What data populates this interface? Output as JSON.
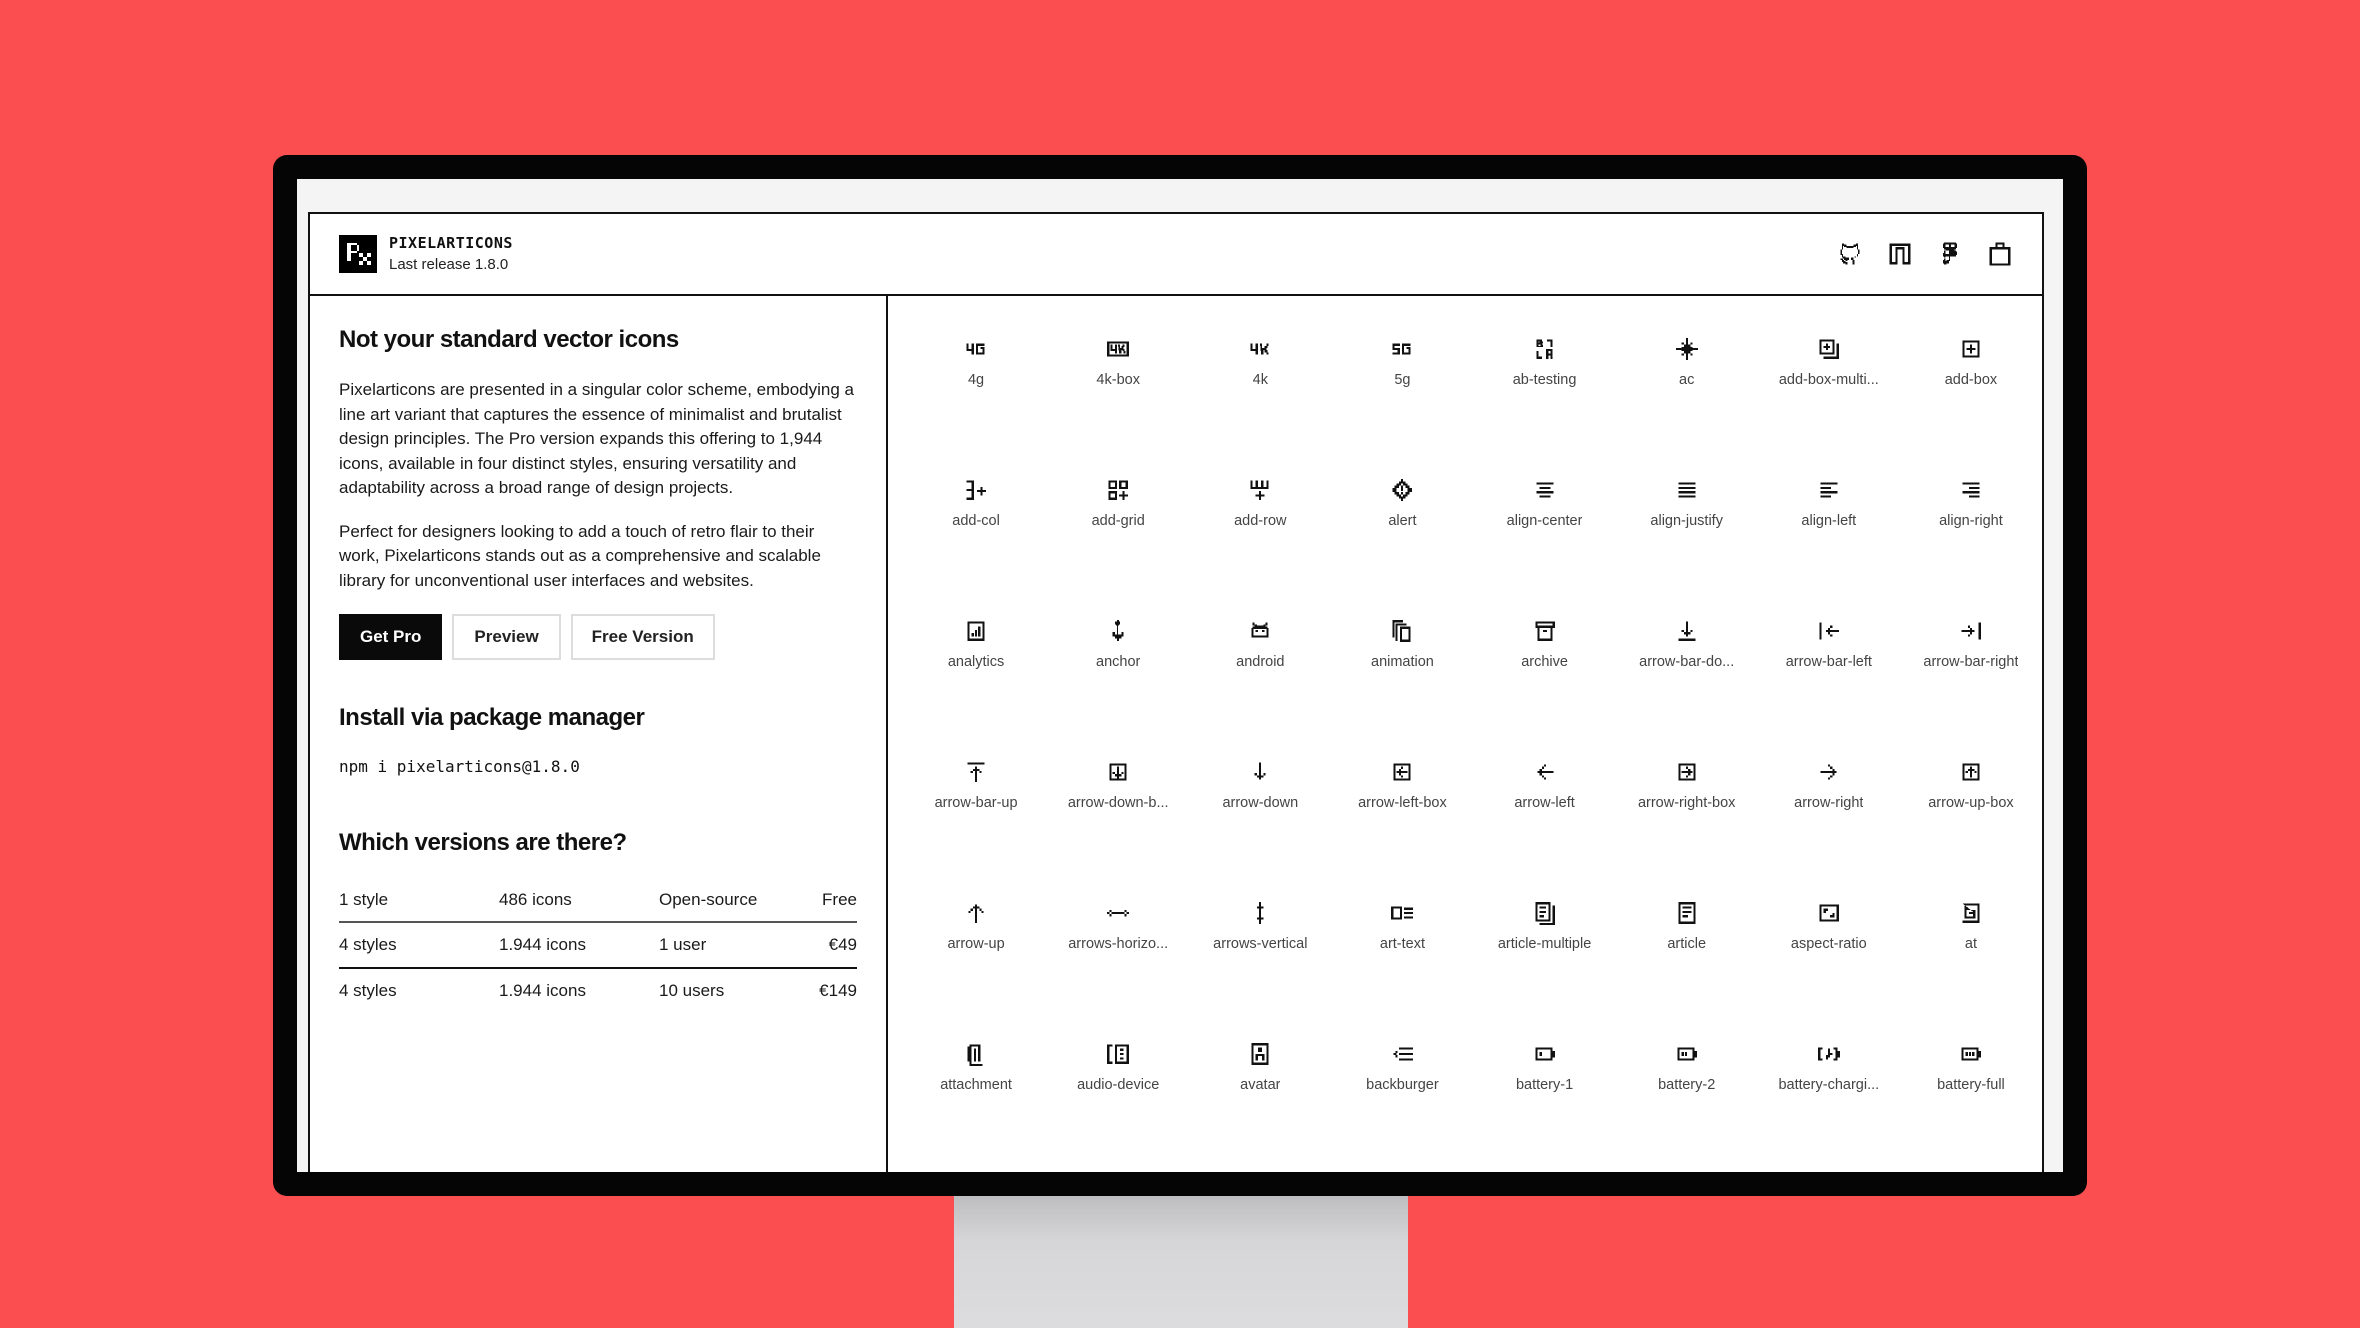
{
  "background_color": "#fb4e50",
  "brand": {
    "name": "PIXELARTICONS",
    "release": "Last release 1.8.0"
  },
  "header_icons": [
    "github-icon",
    "npm-icon",
    "figma-icon",
    "shopping-bag-icon"
  ],
  "left": {
    "title": "Not your standard vector icons",
    "paragraph1": "Pixelarticons are presented in a singular color scheme, embodying a line art variant that captures the essence of minimalist and brutalist design principles. The Pro version expands this offering to 1,944 icons, available in four distinct styles, ensuring versatility and adaptability across a broad range of design projects.",
    "paragraph2": "Perfect for designers looking to add a touch of retro flair to their work, Pixelarticons stands out as a comprehensive and scalable library for unconventional user interfaces and websites.",
    "buttons": {
      "get_pro": "Get Pro",
      "preview": "Preview",
      "free_version": "Free Version"
    },
    "install_title": "Install via package manager",
    "install_command": "npm i pixelarticons@1.8.0",
    "versions_title": "Which versions are there?",
    "versions": [
      [
        "1 style",
        "486 icons",
        "Open-source",
        "Free"
      ],
      [
        "4 styles",
        "1.944 icons",
        "1 user",
        "€49"
      ],
      [
        "4 styles",
        "1.944 icons",
        "10 users",
        "€149"
      ]
    ]
  },
  "icons": [
    "4g",
    "4k-box",
    "4k",
    "5g",
    "ab-testing",
    "ac",
    "add-box-multi...",
    "add-box",
    "add-col",
    "add-grid",
    "add-row",
    "alert",
    "align-center",
    "align-justify",
    "align-left",
    "align-right",
    "analytics",
    "anchor",
    "android",
    "animation",
    "archive",
    "arrow-bar-do...",
    "arrow-bar-left",
    "arrow-bar-right",
    "arrow-bar-up",
    "arrow-down-b...",
    "arrow-down",
    "arrow-left-box",
    "arrow-left",
    "arrow-right-box",
    "arrow-right",
    "arrow-up-box",
    "arrow-up",
    "arrows-horizo...",
    "arrows-vertical",
    "art-text",
    "article-multiple",
    "article",
    "aspect-ratio",
    "at",
    "attachment",
    "audio-device",
    "avatar",
    "backburger",
    "battery-1",
    "battery-2",
    "battery-chargi...",
    "battery-full"
  ]
}
